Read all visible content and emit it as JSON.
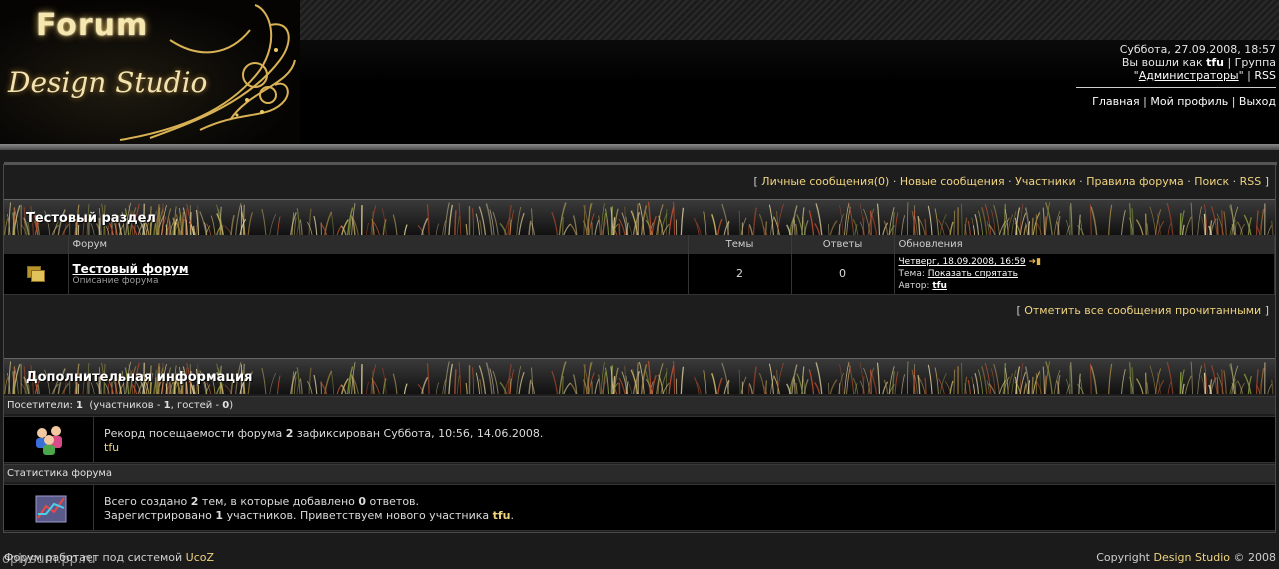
{
  "header": {
    "logo_forum": "Forum",
    "logo_design": "Design Studio",
    "datetime": "Суббота, 27.09.2008, 18:57",
    "logged_prefix": "Вы вошли как",
    "username": "tfu",
    "group_label": "| Группа",
    "group_name": "Администраторы",
    "rss": "RSS",
    "nav": [
      "Главная",
      "Мой профиль",
      "Выход"
    ]
  },
  "quicklinks": [
    "Личные сообщения(0)",
    "Новые сообщения",
    "Участники",
    "Правила форума",
    "Поиск",
    "RSS"
  ],
  "section": {
    "title": "Тестовый раздел",
    "columns": [
      "Форум",
      "Темы",
      "Ответы",
      "Обновления"
    ],
    "forum": {
      "name": "Тестовый форум",
      "desc": "Описание форума",
      "topics": "2",
      "replies": "0",
      "last_date": "Четверг, 18.09.2008, 16:59",
      "topic_label": "Тема:",
      "topic_name": "Показать спрятать",
      "author_label": "Автор:",
      "author": "tfu"
    }
  },
  "mark_read": "Отметить все сообщения прочитанными",
  "info": {
    "title": "Дополнительная информация",
    "visitors": {
      "label": "Посетители:",
      "total": "1",
      "members_label": "участников -",
      "members": "1",
      "guests_label": "гостей -",
      "guests": "0"
    },
    "record_text": "Рекорд посещаемости форума",
    "record_count": "2",
    "record_suffix": "зафиксирован Суббота, 10:56, 14.06.2008.",
    "online_user": "tfu",
    "stats_title": "Статистика форума",
    "stats_line1_a": "Всего создано",
    "stats_topics": "2",
    "stats_line1_b": "тем, в которые добавлено",
    "stats_replies": "0",
    "stats_line1_c": "ответов.",
    "stats_line2_a": "Зарегистрировано",
    "stats_users": "1",
    "stats_line2_b": "участников. Приветствуем нового участника",
    "stats_newuser": "tfu"
  },
  "footer": {
    "left_text": "Форум работает под системой",
    "left_link": "UcoZ",
    "copyright": "Copyright",
    "brand": "Design Studio",
    "year": "© 2008",
    "watermark": "opiysum.pp.ru"
  }
}
